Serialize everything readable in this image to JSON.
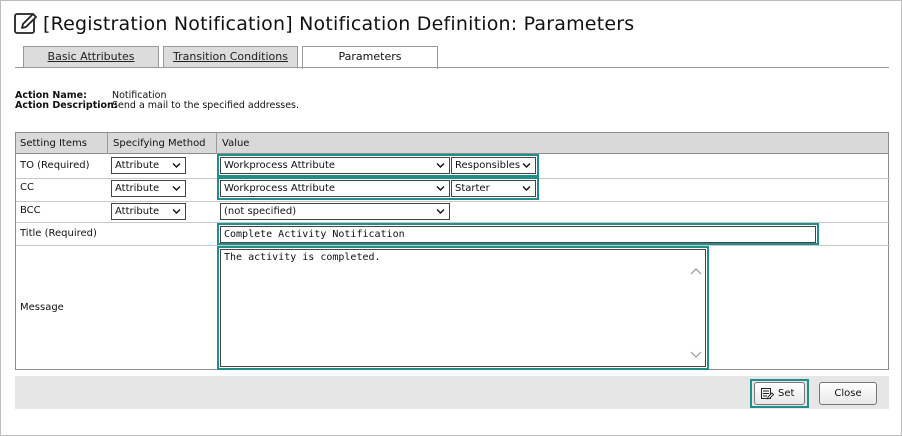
{
  "page": {
    "title": "[Registration Notification] Notification Definition: Parameters"
  },
  "tabs": [
    {
      "label": "Basic Attributes"
    },
    {
      "label": "Transition Conditions"
    },
    {
      "label": "Parameters"
    }
  ],
  "action": {
    "name_label": "Action Name:",
    "name_value": "Notification",
    "description_label": "Action Description:",
    "description_value": "Send a mail to the specified addresses."
  },
  "grid": {
    "headers": [
      "Setting Items",
      "Specifying Method",
      "Value"
    ],
    "rows": {
      "to": {
        "label": "TO (Required)",
        "method": "Attribute",
        "value1": "Workprocess Attribute",
        "value2": "Responsibles"
      },
      "cc": {
        "label": "CC",
        "method": "Attribute",
        "value1": "Workprocess Attribute",
        "value2": "Starter"
      },
      "bcc": {
        "label": "BCC",
        "method": "Attribute",
        "value1": "(not specified)"
      },
      "title": {
        "label": "Title (Required)",
        "value": "Complete Activity Notification"
      },
      "message": {
        "label": "Message",
        "value": "The activity is completed."
      }
    }
  },
  "footer": {
    "set_label": "Set",
    "close_label": "Close"
  },
  "colors": {
    "highlight": "#1f8f8a",
    "header_bg": "#d9d9d9",
    "footer_bg": "#e6e6e6"
  },
  "icons": [
    "edit-icon",
    "chevron-down-icon",
    "set-icon",
    "scroll-up-icon",
    "scroll-down-icon"
  ]
}
